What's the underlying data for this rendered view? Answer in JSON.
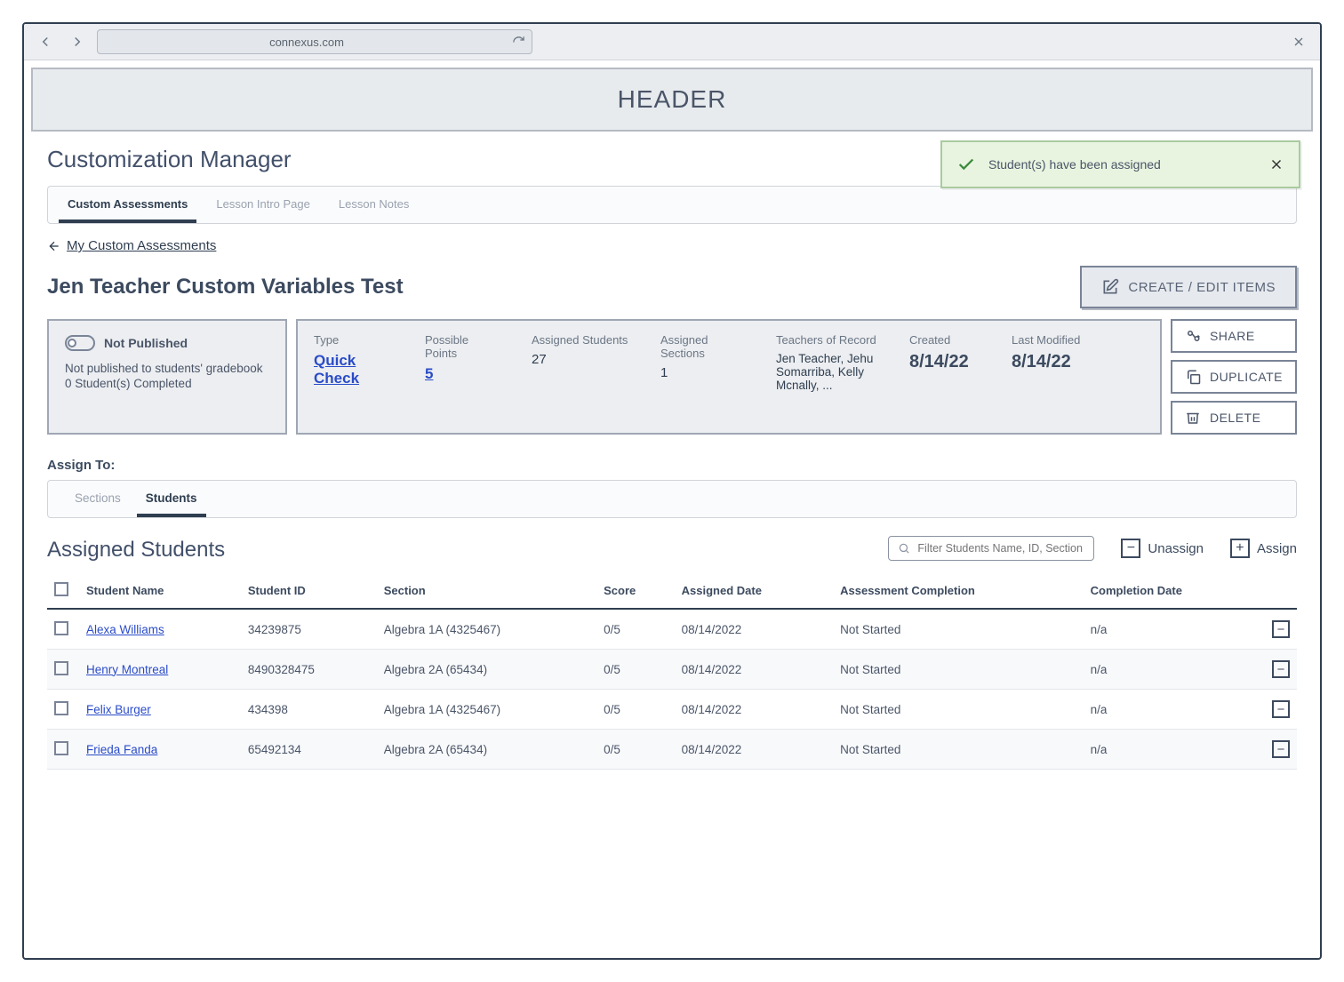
{
  "browser": {
    "url": "connexus.com"
  },
  "header": {
    "label": "HEADER"
  },
  "page": {
    "title": "Customization Manager"
  },
  "toast": {
    "message": "Student(s) have been assigned"
  },
  "top_tabs": [
    {
      "label": "Custom Assessments",
      "active": true
    },
    {
      "label": "Lesson Intro Page",
      "active": false
    },
    {
      "label": "Lesson Notes",
      "active": false
    }
  ],
  "breadcrumb": {
    "link": "My Custom Assessments"
  },
  "assessment": {
    "title": "Jen Teacher Custom Variables Test",
    "create_edit_label": "CREATE / EDIT ITEMS"
  },
  "status": {
    "label": "Not Published",
    "line1": "Not published to students' gradebook",
    "line2": "0 Student(s) Completed"
  },
  "facts": {
    "type_label": "Type",
    "type_value": "Quick Check",
    "points_label": "Possible Points",
    "points_value": "5",
    "students_label": "Assigned Students",
    "students_value": "27",
    "sections_label": "Assigned Sections",
    "sections_value": "1",
    "teachers_label": "Teachers of Record",
    "teachers_value": "Jen Teacher, Jehu Somarriba, Kelly Mcnally, ...",
    "created_label": "Created",
    "created_value": "8/14/22",
    "modified_label": "Last Modified",
    "modified_value": "8/14/22"
  },
  "actions": {
    "share": "SHARE",
    "duplicate": "DUPLICATE",
    "delete": "DELETE"
  },
  "assign": {
    "section_label": "Assign To:",
    "tabs": [
      {
        "label": "Sections",
        "active": false
      },
      {
        "label": "Students",
        "active": true
      }
    ],
    "table_title": "Assigned Students",
    "filter_placeholder": "Filter Students Name, ID, Section",
    "unassign_label": "Unassign",
    "assign_label": "Assign"
  },
  "table": {
    "columns": {
      "name": "Student Name",
      "id": "Student ID",
      "section": "Section",
      "score": "Score",
      "assigned": "Assigned Date",
      "completion": "Assessment Completion",
      "comp_date": "Completion Date"
    },
    "rows": [
      {
        "name": "Alexa Williams",
        "id": "34239875",
        "section": "Algebra 1A (4325467)",
        "score": "0/5",
        "assigned": "08/14/2022",
        "completion": "Not Started",
        "comp_date": "n/a"
      },
      {
        "name": "Henry Montreal",
        "id": "8490328475",
        "section": "Algebra 2A (65434)",
        "score": "0/5",
        "assigned": "08/14/2022",
        "completion": "Not Started",
        "comp_date": "n/a"
      },
      {
        "name": "Felix Burger",
        "id": "434398",
        "section": "Algebra 1A (4325467)",
        "score": "0/5",
        "assigned": "08/14/2022",
        "completion": "Not Started",
        "comp_date": "n/a"
      },
      {
        "name": "Frieda Fanda",
        "id": "65492134",
        "section": "Algebra 2A (65434)",
        "score": "0/5",
        "assigned": "08/14/2022",
        "completion": "Not Started",
        "comp_date": "n/a"
      }
    ]
  }
}
